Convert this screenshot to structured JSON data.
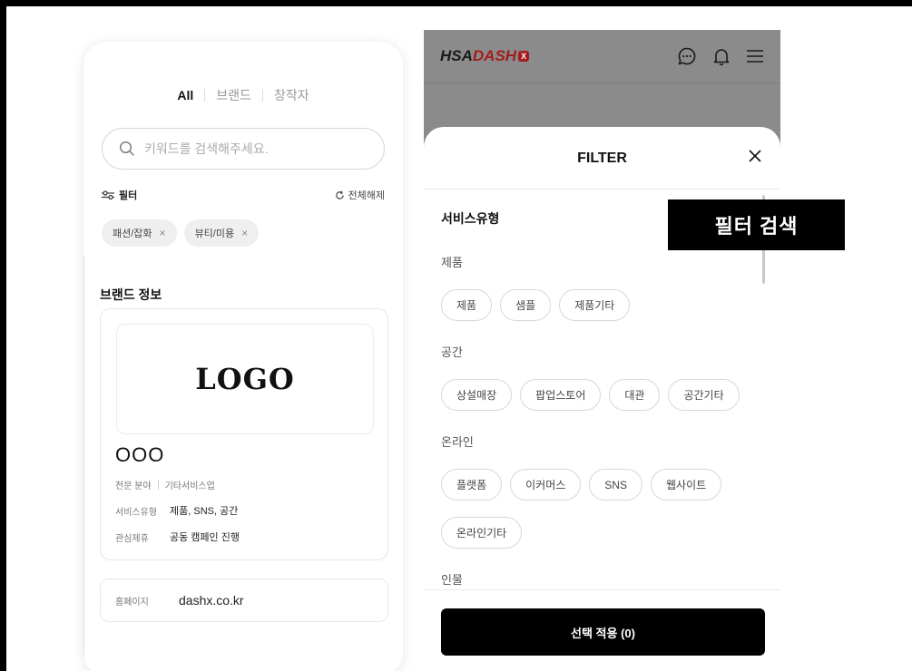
{
  "left_screen": {
    "tabs": [
      {
        "label": "All",
        "active": true
      },
      {
        "label": "브랜드",
        "active": false
      },
      {
        "label": "창작자",
        "active": false
      }
    ],
    "search": {
      "placeholder": "키워드를 검색해주세요."
    },
    "filter_label": "필터",
    "reset_label": "전체해제",
    "active_chips": [
      {
        "label": "패션/잡화"
      },
      {
        "label": "뷰티/미용"
      }
    ],
    "section_title": "브랜드 정보",
    "brand_card": {
      "logo_text": "LOGO",
      "name": "OOO",
      "field_label": "전문 분야",
      "field_value": "기타서비스업",
      "service_type_label": "서비스유형",
      "service_type_value": "제품, SNS, 공간",
      "interest_label": "관심제휴",
      "interest_value": "공동 캠페인 진행"
    },
    "homepage": {
      "label": "홈페이지",
      "value": "dashx.co.kr"
    }
  },
  "right_screen": {
    "brand_logo": {
      "main": "HSA",
      "accent": "DASH",
      "badge": "X"
    },
    "sheet_title": "FILTER",
    "group_title": "서비스유형",
    "categories": [
      {
        "title": "제품",
        "options": [
          "제품",
          "샘플",
          "제품기타"
        ]
      },
      {
        "title": "공간",
        "options": [
          "상설매장",
          "팝업스토어",
          "대관",
          "공간기타"
        ]
      },
      {
        "title": "온라인",
        "options": [
          "플랫폼",
          "이커머스",
          "SNS",
          "웹사이트",
          "온라인기타"
        ]
      },
      {
        "title": "인물",
        "options": []
      }
    ],
    "apply_button": "선택 적용 (0)"
  },
  "annotation": "필터 검색",
  "colors": {
    "overlay": "#8b8b8b",
    "brand_red": "#a21d1d",
    "button_black": "#000000"
  }
}
